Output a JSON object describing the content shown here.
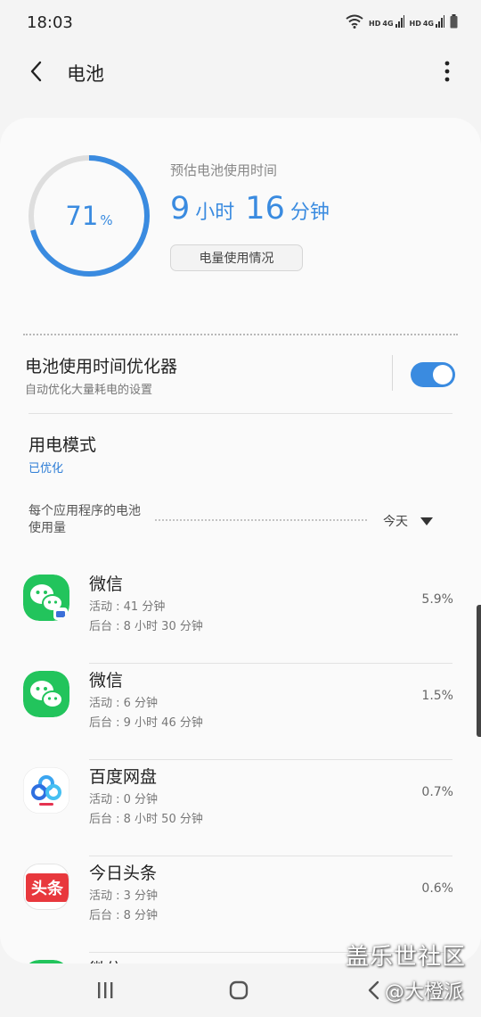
{
  "status_bar": {
    "time": "18:03",
    "signal_label_1": "HD",
    "signal_label_2": "HD",
    "network_1": "4G",
    "network_2": "4G"
  },
  "app_bar": {
    "title": "电池",
    "back_icon": "chevron-left-icon",
    "more_icon": "more-vert-icon"
  },
  "battery": {
    "level": 71,
    "level_text": "71",
    "level_unit": "%",
    "ring_color": "#3a8be0",
    "estimate_label": "预估电池使用时间",
    "hours": "9",
    "hours_unit": "小时",
    "minutes": "16",
    "minutes_unit": "分钟",
    "usage_button": "电量使用情况"
  },
  "optimizer": {
    "title": "电池使用时间优化器",
    "subtitle": "自动优化大量耗电的设置",
    "enabled": true
  },
  "power_mode": {
    "title": "用电模式",
    "value": "已优化"
  },
  "app_usage": {
    "section_label": "每个应用程序的电池使用量",
    "period": "今天",
    "apps": [
      {
        "name": "微信",
        "icon": "wechat-icon",
        "active": "活动 : 41 分钟",
        "background": "后台 : 8 小时 30 分钟",
        "percent": "5.9%"
      },
      {
        "name": "微信",
        "icon": "wechat-icon",
        "active": "活动 : 6 分钟",
        "background": "后台 : 9 小时 46 分钟",
        "percent": "1.5%"
      },
      {
        "name": "百度网盘",
        "icon": "baidu-netdisk-icon",
        "active": "活动 : 0 分钟",
        "background": "后台 : 8 小时 50 分钟",
        "percent": "0.7%"
      },
      {
        "name": "今日头条",
        "icon": "toutiao-icon",
        "active": "活动 : 3 分钟",
        "background": "后台 : 8 分钟",
        "percent": "0.6%"
      },
      {
        "name": "微信",
        "icon": "wechat-icon"
      }
    ],
    "toutiao_logo_text": "头条"
  },
  "nav_bar": {
    "recents_icon": "recents-icon",
    "home_icon": "home-icon",
    "back_icon": "back-icon"
  },
  "watermark": {
    "line1": "盖乐世社区",
    "line2": "@大橙派"
  }
}
